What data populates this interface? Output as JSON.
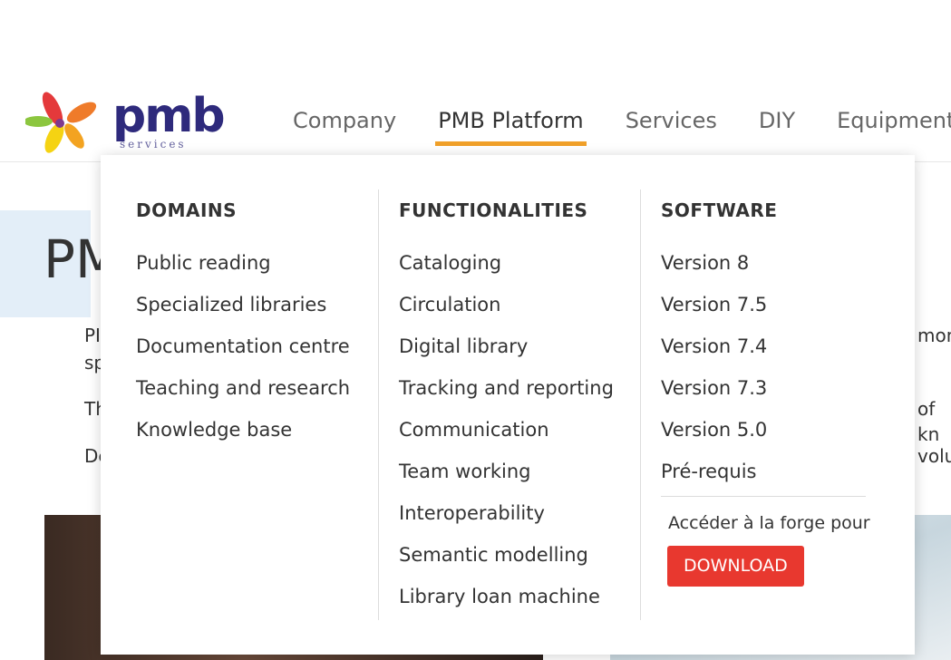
{
  "header": {
    "logo": {
      "text": "pmb",
      "subtext": "services"
    },
    "nav": [
      {
        "label": "Company"
      },
      {
        "label": "PMB Platform",
        "active": true
      },
      {
        "label": "Services"
      },
      {
        "label": "DIY"
      },
      {
        "label": "Equipment"
      }
    ],
    "accent_color": "#f0a029"
  },
  "background": {
    "title_fragment": "PM",
    "line1_left": "PI",
    "line1_right": "mong",
    "line2_left": "sp",
    "line3_left": "Th",
    "line3_right": "of kn",
    "line4_left": "De",
    "line4_right": "volut"
  },
  "megamenu": {
    "domains": {
      "heading": "DOMAINS",
      "items": [
        "Public reading",
        "Specialized libraries",
        "Documentation centre",
        "Teaching and research",
        "Knowledge base"
      ]
    },
    "functionalities": {
      "heading": "FUNCTIONALITIES",
      "items": [
        "Cataloging",
        "Circulation",
        "Digital library",
        "Tracking and reporting",
        "Communication",
        "Team working",
        "Interoperability",
        "Semantic modelling",
        "Library loan machine"
      ]
    },
    "software": {
      "heading": "SOFTWARE",
      "items": [
        "Version 8",
        "Version 7.5",
        "Version 7.4",
        "Version 7.3",
        "Version 5.0",
        "Pré-requis"
      ],
      "forge_text": "Accéder à la forge pour",
      "download_label": "DOWNLOAD",
      "download_color": "#e8382f"
    }
  }
}
